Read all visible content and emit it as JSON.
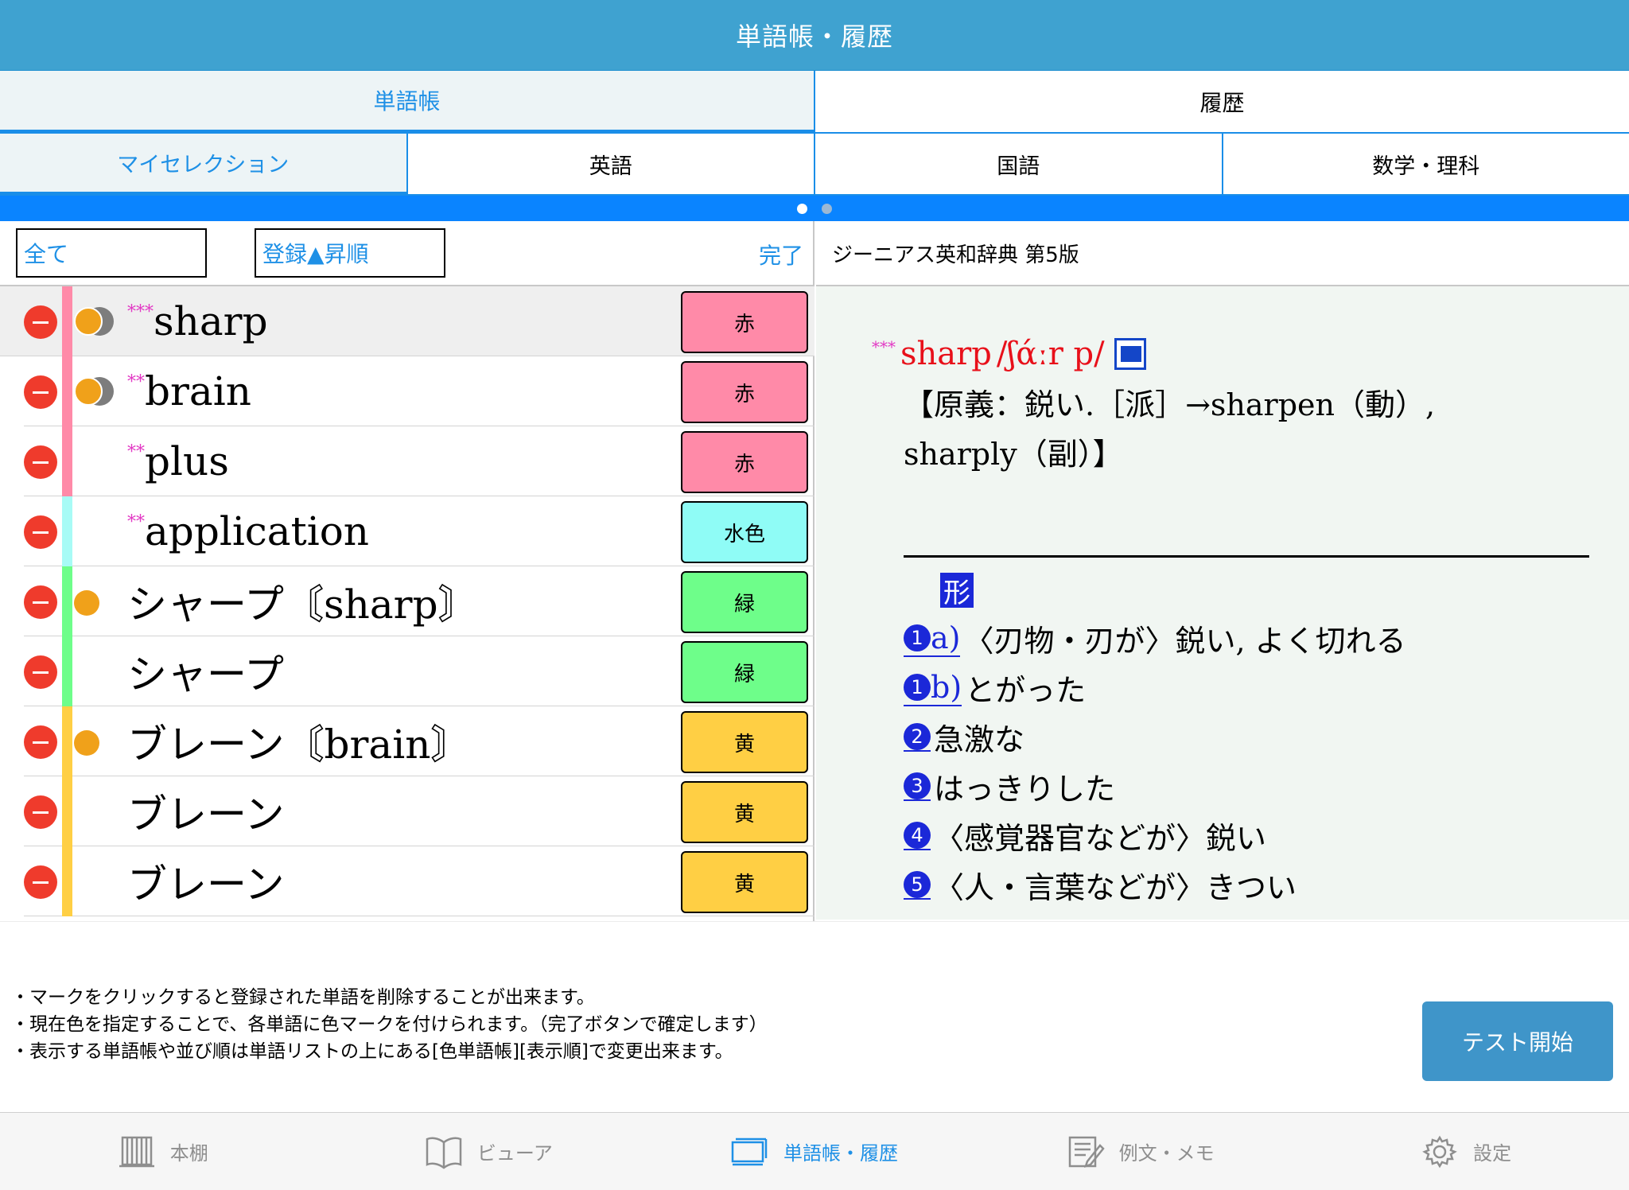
{
  "header": {
    "title": "単語帳・履歴"
  },
  "main_tabs": [
    {
      "label": "単語帳",
      "active": true
    },
    {
      "label": "履歴",
      "active": false
    }
  ],
  "sub_tabs": [
    {
      "label": "マイセレクション",
      "active": true
    },
    {
      "label": "英語",
      "active": false
    },
    {
      "label": "国語",
      "active": false
    },
    {
      "label": "数学・理科",
      "active": false
    }
  ],
  "toolbar": {
    "filter_value": "全て",
    "order_value": "登録▲昇順",
    "done_label": "完了"
  },
  "words": [
    {
      "word": "sharp",
      "star": "***",
      "color_label": "赤",
      "color": "#ff8aa8",
      "bar": "#ff8aa8",
      "mark": "double"
    },
    {
      "word": "brain",
      "star": "**",
      "color_label": "赤",
      "color": "#ff8aa8",
      "bar": "#ff8aa8",
      "mark": "double"
    },
    {
      "word": "plus",
      "star": "**",
      "color_label": "赤",
      "color": "#ff8aa8",
      "bar": "#ff8aa8",
      "mark": "none"
    },
    {
      "word": "application",
      "star": "**",
      "color_label": "水色",
      "color": "#8ffcf6",
      "bar": "#a8fbf6",
      "mark": "none"
    },
    {
      "word": "シャープ〘sharp〙",
      "star": "",
      "color_label": "緑",
      "color": "#6efe8a",
      "bar": "#6efe8a",
      "mark": "single"
    },
    {
      "word": "シャープ",
      "star": "",
      "color_label": "緑",
      "color": "#6efe8a",
      "bar": "#6efe8a",
      "mark": "none"
    },
    {
      "word": "ブレーン〘brain〙",
      "star": "",
      "color_label": "黄",
      "color": "#ffcf44",
      "bar": "#ffcf44",
      "mark": "single"
    },
    {
      "word": "ブレーン",
      "star": "",
      "color_label": "黄",
      "color": "#ffcf44",
      "bar": "#ffcf44",
      "mark": "none"
    },
    {
      "word": "ブレーン",
      "star": "",
      "color_label": "黄",
      "color": "#ffcf44",
      "bar": "#ffcf44",
      "mark": "none"
    }
  ],
  "dictionary": {
    "name": "ジーニアス英和辞典 第5版",
    "star": "***",
    "headword": "sharp",
    "pronunciation": "/ʃάːr p/",
    "origin_line1": "【原義：鋭い.［派］→sharpen（動）,",
    "origin_line2": "sharply（副）】",
    "pos": "形",
    "senses": [
      {
        "num": "1",
        "sub": "a)",
        "text": "〈刃物・刃が〉鋭い, よく切れる"
      },
      {
        "num": "1",
        "sub": "b)",
        "text": "とがった"
      },
      {
        "num": "2",
        "sub": "",
        "text": "急激な"
      },
      {
        "num": "3",
        "sub": "",
        "text": "はっきりした"
      },
      {
        "num": "4",
        "sub": "",
        "text": "〈感覚器官などが〉鋭い"
      },
      {
        "num": "5",
        "sub": "",
        "text": "〈人・言葉などが〉きつい"
      }
    ]
  },
  "notes": [
    "・マークをクリックすると登録された単語を削除することが出来ます。",
    "・現在色を指定することで、各単語に色マークを付けられます。（完了ボタンで確定します）",
    "・表示する単語帳や並び順は単語リストの上にある[色単語帳][表示順]で変更出来ます。"
  ],
  "test_button": "テスト開始",
  "tabbar": [
    {
      "label": "本棚",
      "icon": "bookshelf-icon",
      "active": false
    },
    {
      "label": "ビューア",
      "icon": "open-book-icon",
      "active": false
    },
    {
      "label": "単語帳・履歴",
      "icon": "cards-icon",
      "active": true
    },
    {
      "label": "例文・メモ",
      "icon": "memo-icon",
      "active": false
    },
    {
      "label": "設定",
      "icon": "gear-icon",
      "active": false
    }
  ]
}
